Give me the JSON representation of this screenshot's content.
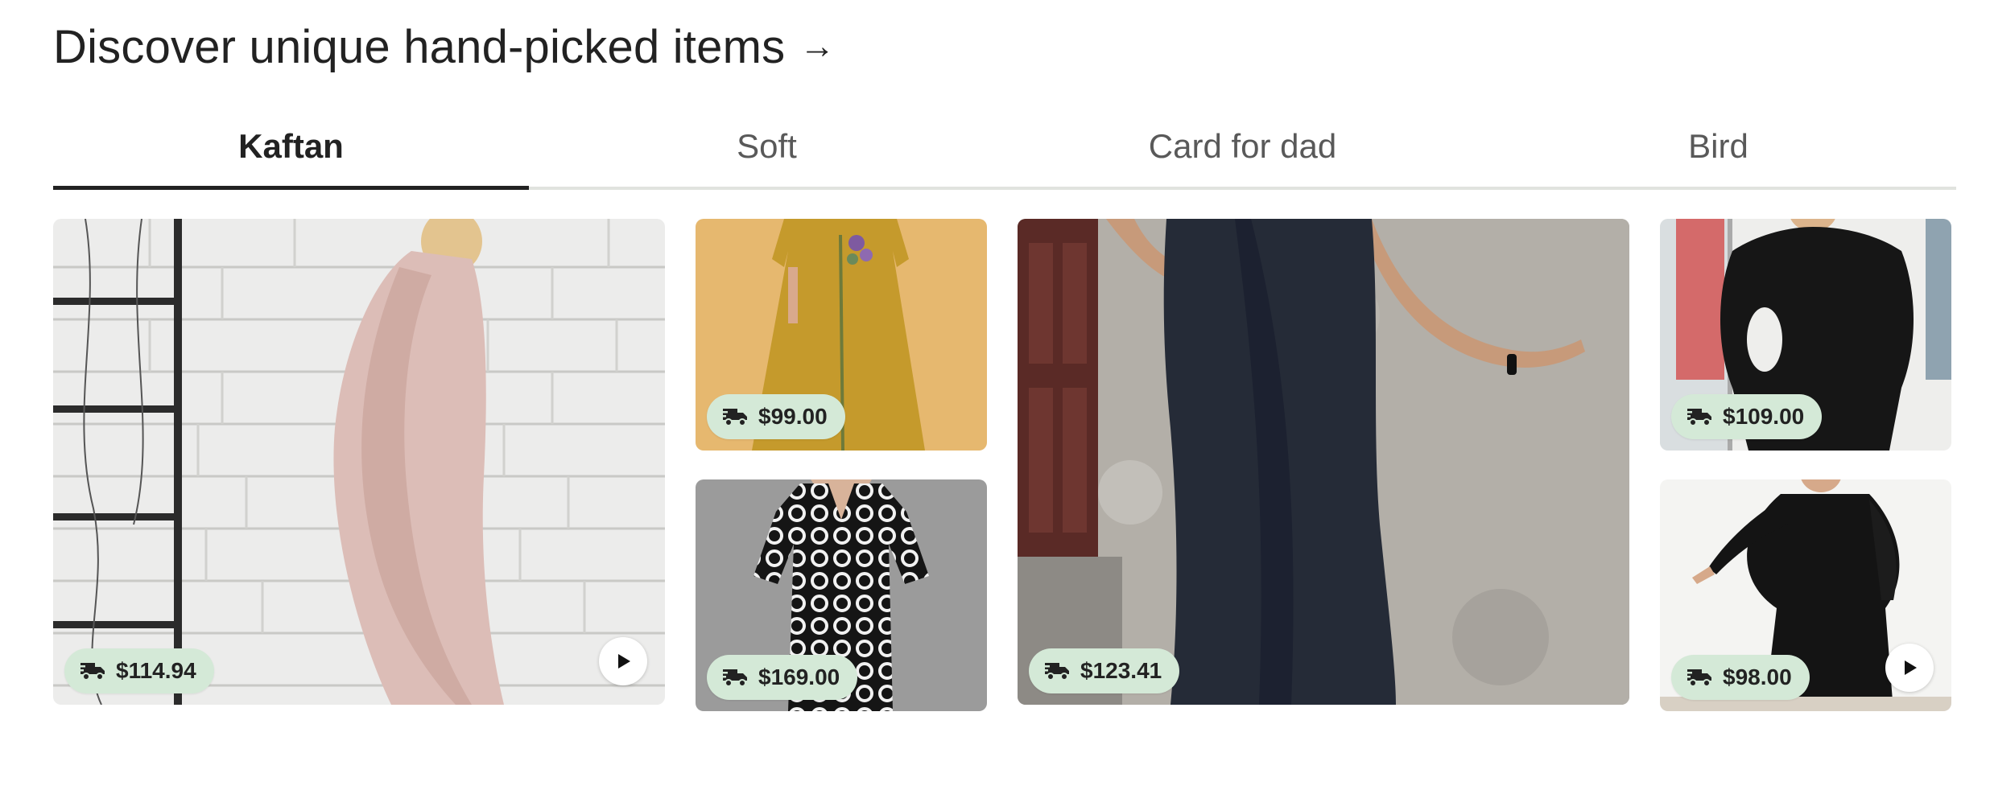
{
  "section": {
    "title": "Discover unique hand-picked items",
    "arrow_icon": "arrow-right-icon"
  },
  "tabs": [
    {
      "label": "Kaftan",
      "active": true
    },
    {
      "label": "Soft",
      "active": false
    },
    {
      "label": "Card for dad",
      "active": false
    },
    {
      "label": "Bird",
      "active": false
    }
  ],
  "items": [
    {
      "price": "$114.94",
      "has_video": true,
      "image": "pink linen kaftan against white brick wall"
    },
    {
      "price": "$99.00",
      "has_video": false,
      "image": "mustard yellow embroidered linen dress"
    },
    {
      "price": "$169.00",
      "has_video": false,
      "image": "black and white polka dot kaftan dress"
    },
    {
      "price": "$123.41",
      "has_video": false,
      "image": "dark navy linen sleeveless dress"
    },
    {
      "price": "$109.00",
      "has_video": false,
      "image": "black batwing kaftan by window"
    },
    {
      "price": "$98.00",
      "has_video": true,
      "image": "black off-shoulder kaftan dress"
    }
  ],
  "icons": {
    "shipping": "truck-icon",
    "video": "play-icon"
  },
  "colors": {
    "badge_bg": "#d4e9d7",
    "text_primary": "#222222",
    "text_secondary": "#595959",
    "tab_underline": "#222222",
    "divider": "#e1e3df"
  }
}
